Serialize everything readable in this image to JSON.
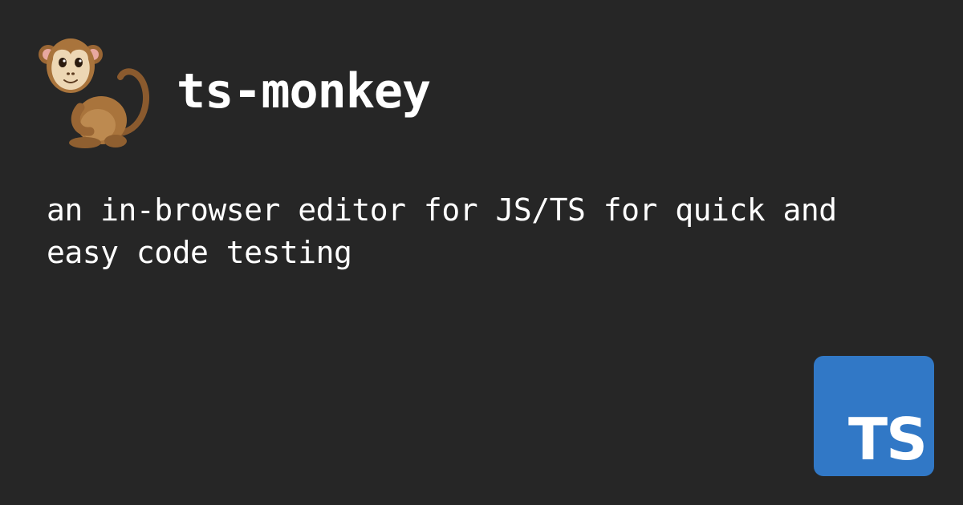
{
  "header": {
    "title": "ts-monkey",
    "logo_icon": "monkey-icon"
  },
  "tagline": "an in-browser editor for JS/TS for quick and easy code testing",
  "badge": {
    "label": "TS",
    "color": "#3178c6"
  },
  "colors": {
    "background": "#262626",
    "text": "#ffffff"
  }
}
